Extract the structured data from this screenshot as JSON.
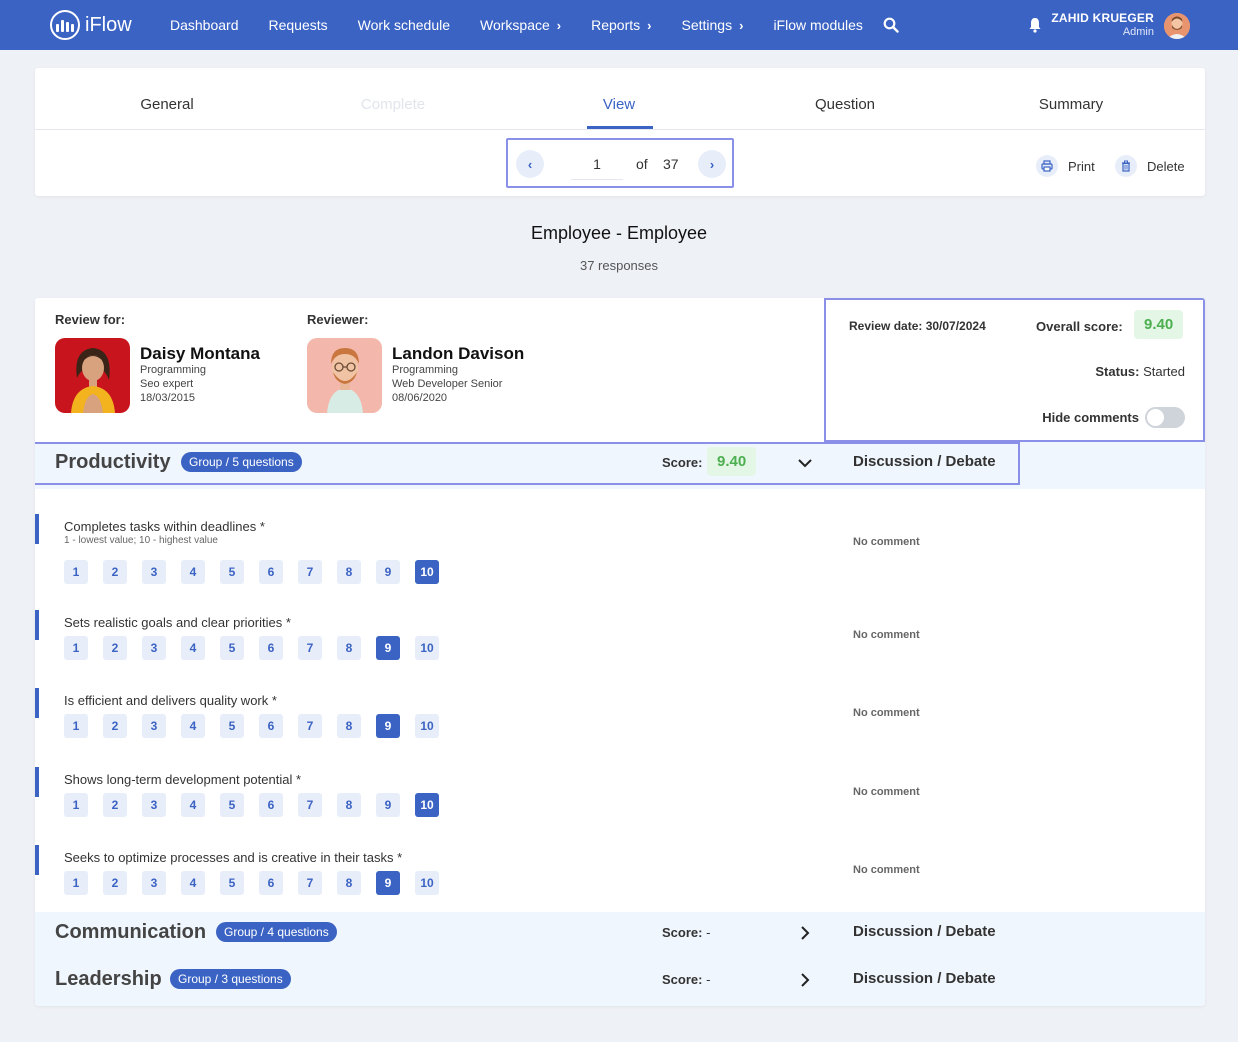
{
  "app": {
    "name": "iFlow"
  },
  "nav": {
    "items": [
      {
        "label": "Dashboard",
        "chevron": false
      },
      {
        "label": "Requests",
        "chevron": false
      },
      {
        "label": "Work schedule",
        "chevron": false
      },
      {
        "label": "Workspace",
        "chevron": true
      },
      {
        "label": "Reports",
        "chevron": true
      },
      {
        "label": "Settings",
        "chevron": true
      },
      {
        "label": "iFlow modules",
        "chevron": false
      }
    ],
    "chevron_glyph": "›"
  },
  "user": {
    "name": "ZAHID KRUEGER",
    "role": "Admin"
  },
  "tabs": [
    {
      "label": "General",
      "state": "normal"
    },
    {
      "label": "Complete",
      "state": "disabled"
    },
    {
      "label": "View",
      "state": "active"
    },
    {
      "label": "Question",
      "state": "normal"
    },
    {
      "label": "Summary",
      "state": "normal"
    }
  ],
  "pager": {
    "current": "1",
    "of_label": "of",
    "total": "37",
    "prev_glyph": "‹",
    "next_glyph": "›"
  },
  "actions": {
    "print_label": "Print",
    "delete_label": "Delete"
  },
  "page": {
    "title": "Employee - Employee",
    "responses": "37 responses"
  },
  "review_for": {
    "label": "Review for:",
    "name": "Daisy Montana",
    "department": "Programming",
    "position": "Seo expert",
    "date": "18/03/2015"
  },
  "reviewer": {
    "label": "Reviewer:",
    "name": "Landon Davison",
    "department": "Programming",
    "position": "Web Developer Senior",
    "date": "08/06/2020"
  },
  "meta": {
    "review_date": "Review date: 30/07/2024",
    "overall_label": "Overall score:",
    "overall_score": "9.40",
    "status_label": "Status:",
    "status_value": "Started",
    "hide_comments_label": "Hide comments",
    "hide_comments_on": false
  },
  "groups": [
    {
      "title": "Productivity",
      "badge": "Group / 5 questions",
      "score_label": "Score:",
      "score": "9.40",
      "expanded": true,
      "debate": "Discussion / Debate"
    },
    {
      "title": "Communication",
      "badge": "Group / 4 questions",
      "score_label": "Score:",
      "score": "-",
      "expanded": false,
      "debate": "Discussion / Debate"
    },
    {
      "title": "Leadership",
      "badge": "Group / 3 questions",
      "score_label": "Score:",
      "score": "-",
      "expanded": false,
      "debate": "Discussion / Debate"
    }
  ],
  "scale": [
    "1",
    "2",
    "3",
    "4",
    "5",
    "6",
    "7",
    "8",
    "9",
    "10"
  ],
  "questions": [
    {
      "text": "Completes tasks within deadlines *",
      "hint": "1 - lowest value; 10 - highest value",
      "selected": 10,
      "comment": "No comment"
    },
    {
      "text": "Sets realistic goals and clear priorities *",
      "hint": "",
      "selected": 9,
      "comment": "No comment"
    },
    {
      "text": "Is efficient and delivers quality work *",
      "hint": "",
      "selected": 9,
      "comment": "No comment"
    },
    {
      "text": "Shows long-term development potential *",
      "hint": "",
      "selected": 10,
      "comment": "No comment"
    },
    {
      "text": "Seeks to optimize processes and is creative in their tasks *",
      "hint": "",
      "selected": 9,
      "comment": "No comment"
    }
  ],
  "colors": {
    "primary": "#3b63c4",
    "score_bg": "#e4f6e6",
    "score_text": "#4caf50",
    "highlight": "#8a8fe8"
  }
}
